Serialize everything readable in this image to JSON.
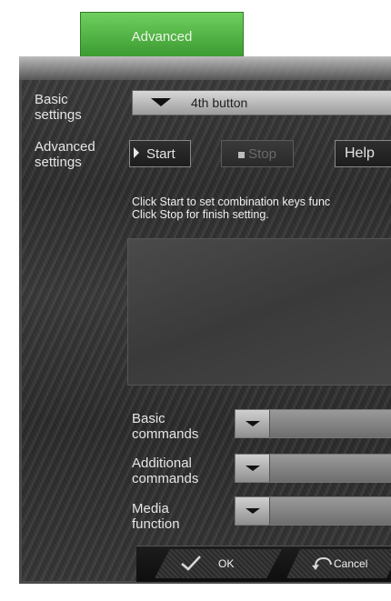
{
  "tabs": {
    "advanced": "Advanced"
  },
  "labels": {
    "basic_settings": "Basic\nsettings",
    "advanced_settings": "Advanced\nsettings",
    "basic_commands": "Basic\ncommands",
    "additional_commands": "Additional\ncommands",
    "media_function": "Media\nfunction"
  },
  "basic_settings_select": {
    "value": "4th button"
  },
  "buttons": {
    "start": "Start",
    "stop": "Stop",
    "help": "Help"
  },
  "info": {
    "line1": "Click Start to set combination keys func",
    "line2": " Click Stop for finish setting."
  },
  "footer": {
    "ok": "OK",
    "cancel": "Cancel"
  },
  "icons": {
    "start": "play-icon",
    "stop": "stop-icon",
    "ok": "checkmark-icon",
    "cancel": "undo-arrow-icon",
    "dropdown": "chevron-down-icon"
  },
  "colors": {
    "tab_green": "#4caf3e",
    "panel_bg": "#333333"
  }
}
